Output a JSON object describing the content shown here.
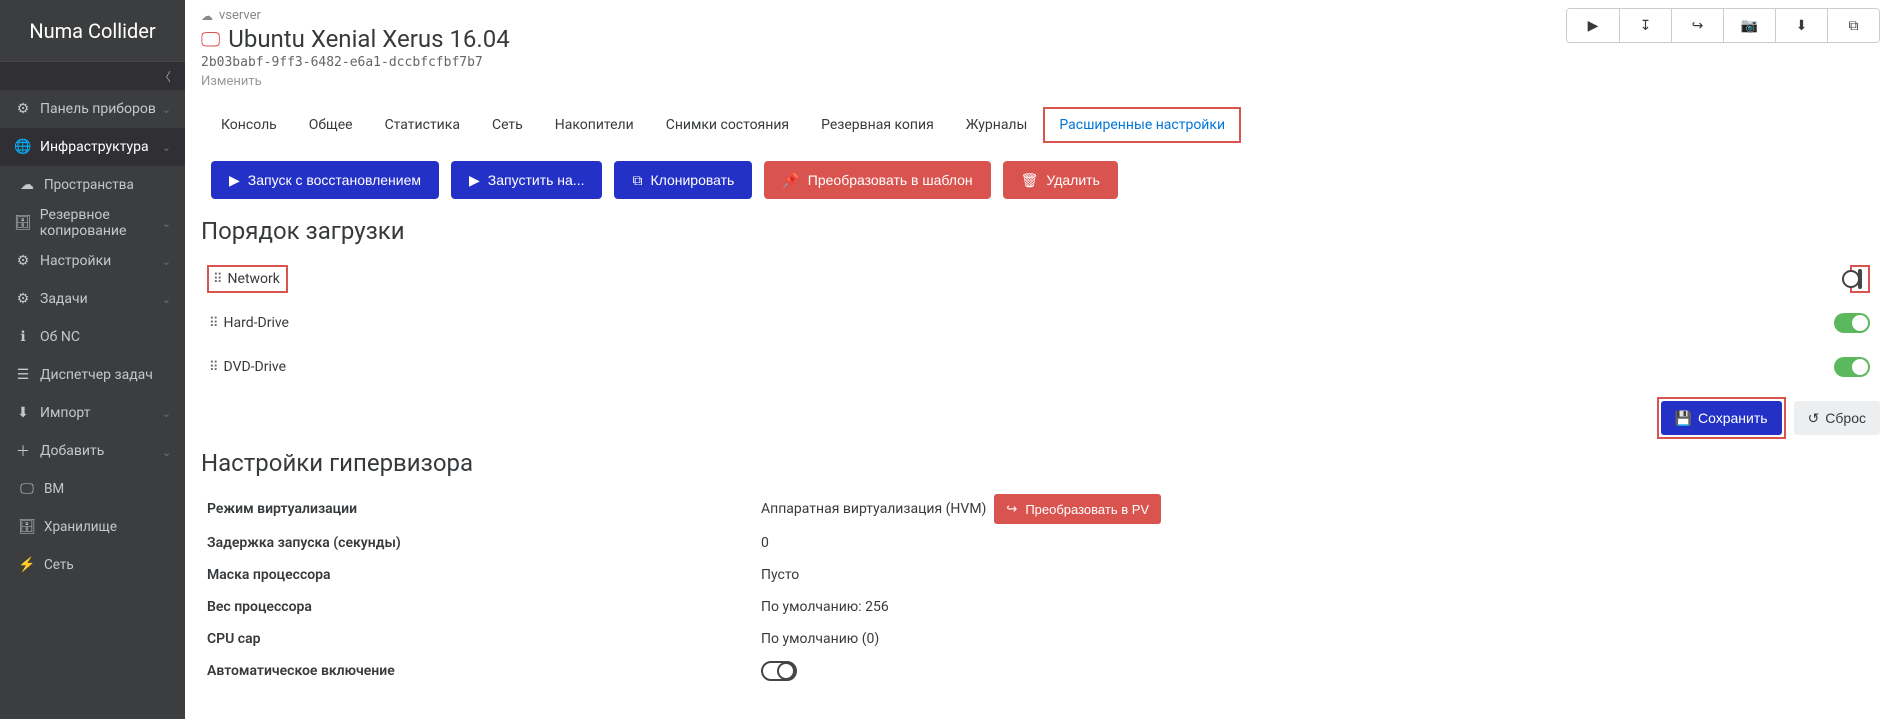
{
  "brand": "Numa Collider",
  "sidebar": {
    "items": [
      {
        "icon": "⚙",
        "label": "Панель приборов",
        "chev": "⌄"
      },
      {
        "icon": "🌐",
        "label": "Инфраструктура",
        "chev": "⌄",
        "active": true
      },
      {
        "icon": "☁",
        "label": "Пространства",
        "sub": true
      },
      {
        "icon": "🗄",
        "label": "Резервное копирование",
        "chev": "⌄"
      },
      {
        "icon": "⚙",
        "label": "Настройки",
        "chev": "⌄"
      },
      {
        "icon": "⚙",
        "label": "Задачи",
        "chev": "⌄"
      },
      {
        "icon": "ℹ",
        "label": "Об NC"
      },
      {
        "icon": "☰",
        "label": "Диспетчер задач"
      },
      {
        "icon": "⬇",
        "label": "Импорт",
        "chev": "⌄"
      },
      {
        "icon": "＋",
        "label": "Добавить",
        "chev": "⌃",
        "add": true
      },
      {
        "icon": "🖵",
        "label": "ВМ",
        "sub": true
      },
      {
        "icon": "🗄",
        "label": "Хранилище",
        "sub": true
      },
      {
        "icon": "⚡",
        "label": "Сеть",
        "sub": true
      }
    ]
  },
  "header": {
    "server": "vserver",
    "title": "Ubuntu Xenial Xerus 16.04",
    "uuid": "2b03babf-9ff3-6482-e6a1-dccbfcfbf7b7",
    "edit": "Изменить"
  },
  "tabs": [
    "Консоль",
    "Общее",
    "Статистика",
    "Сеть",
    "Накопители",
    "Снимки состояния",
    "Резервная копия",
    "Журналы",
    "Расширенные настройки"
  ],
  "actions": {
    "recovery": "Запуск с восстановлением",
    "startOn": "Запустить на...",
    "clone": "Клонировать",
    "toTemplate": "Преобразовать в шаблон",
    "delete": "Удалить"
  },
  "boot": {
    "heading": "Порядок загрузки",
    "items": [
      {
        "label": "Network",
        "on": false,
        "hl": true
      },
      {
        "label": "Hard-Drive",
        "on": true
      },
      {
        "label": "DVD-Drive",
        "on": true
      }
    ],
    "save": "Сохранить",
    "reset": "Сброс"
  },
  "hv": {
    "heading": "Настройки гипервизора",
    "rows": [
      {
        "k": "Режим виртуализации",
        "v": "Аппаратная виртуализация (HVM)",
        "btn": "Преобразовать в PV"
      },
      {
        "k": "Задержка запуска (секунды)",
        "v": "0"
      },
      {
        "k": "Маска процессора",
        "v": "Пусто"
      },
      {
        "k": "Вес процессора",
        "v": "По умолчанию: 256"
      },
      {
        "k": "CPU cap",
        "v": "По умолчанию (0)"
      },
      {
        "k": "Автоматическое включение",
        "toggle": false
      }
    ]
  }
}
